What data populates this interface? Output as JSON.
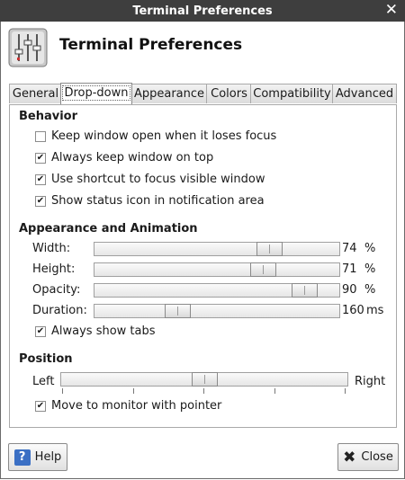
{
  "window": {
    "title": "Terminal Preferences",
    "header_title": "Terminal Preferences"
  },
  "tabs": [
    {
      "label": "General"
    },
    {
      "label": "Drop-down"
    },
    {
      "label": "Appearance"
    },
    {
      "label": "Colors"
    },
    {
      "label": "Compatibility"
    },
    {
      "label": "Advanced"
    }
  ],
  "active_tab": "Drop-down",
  "behavior": {
    "title": "Behavior",
    "options": [
      {
        "label": "Keep window open when it loses focus",
        "checked": false
      },
      {
        "label": "Always keep window on top",
        "checked": true
      },
      {
        "label": "Use shortcut to focus visible window",
        "checked": true
      },
      {
        "label": "Show status icon in notification area",
        "checked": true
      }
    ]
  },
  "appearance": {
    "title": "Appearance and Animation",
    "sliders": [
      {
        "label": "Width:",
        "value": "74",
        "unit": "%",
        "level": 0.74
      },
      {
        "label": "Height:",
        "value": "71",
        "unit": "%",
        "level": 0.71
      },
      {
        "label": "Opacity:",
        "value": "90",
        "unit": "%",
        "level": 0.9
      },
      {
        "label": "Duration:",
        "value": "160",
        "unit": "ms",
        "level": 0.32
      }
    ],
    "always_show_tabs": {
      "label": "Always show tabs",
      "checked": true
    }
  },
  "position": {
    "title": "Position",
    "left_label": "Left",
    "right_label": "Right",
    "level": 0.5,
    "move_to_monitor": {
      "label": "Move to monitor with pointer",
      "checked": true
    }
  },
  "buttons": {
    "help": "Help",
    "close": "Close"
  },
  "icons": {
    "app": "terminal-preferences-icon",
    "help": "help-icon",
    "close": "close-icon"
  },
  "colors": {
    "titlebar": "#3e3e3e",
    "help_icon": "#3a6fc4"
  }
}
